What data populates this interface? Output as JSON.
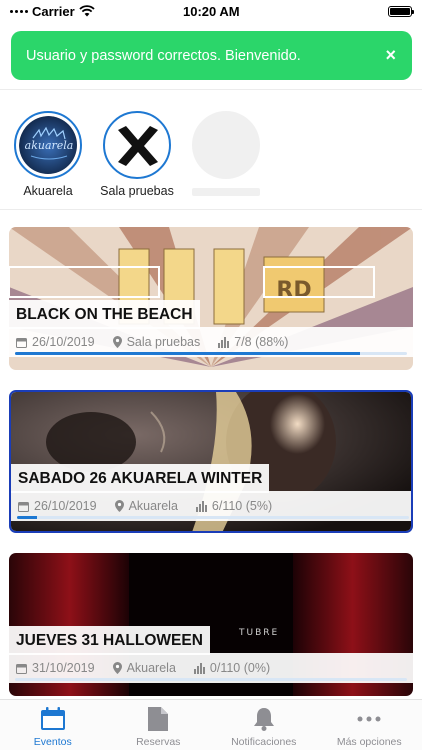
{
  "status": {
    "carrier": "Carrier",
    "time": "10:20 AM"
  },
  "toast": {
    "message": "Usuario y password correctos. Bienvenido.",
    "close": "×"
  },
  "venues": [
    {
      "label": "Akuarela",
      "logo_text": "akuarela"
    },
    {
      "label": "Sala pruebas",
      "logo_text": "X"
    }
  ],
  "events": [
    {
      "title": "BLACK ON THE BEACH",
      "date": "26/10/2019",
      "venue": "Sala pruebas",
      "capacity": "7/8 (88%)",
      "progress": 0.88
    },
    {
      "title": "SABADO 26 AKUARELA WINTER",
      "date": "26/10/2019",
      "venue": "Akuarela",
      "capacity": "6/110 (5%)",
      "progress": 0.05
    },
    {
      "title": "JUEVES 31 HALLOWEEN",
      "date": "31/10/2019",
      "venue": "Akuarela",
      "capacity": "0/110 (0%)",
      "progress": 0.0
    }
  ],
  "event_bg_text": {
    "rd": "RD",
    "tubre": "TUBRE"
  },
  "tabs": [
    {
      "label": "Eventos",
      "icon": "calendar-icon",
      "active": true
    },
    {
      "label": "Reservas",
      "icon": "document-icon",
      "active": false
    },
    {
      "label": "Notificaciones",
      "icon": "bell-icon",
      "active": false
    },
    {
      "label": "Más opciones",
      "icon": "more-icon",
      "active": false
    }
  ],
  "colors": {
    "accent": "#1e78d2",
    "toast": "#2bd66a",
    "selected_border": "#1a3db8"
  }
}
